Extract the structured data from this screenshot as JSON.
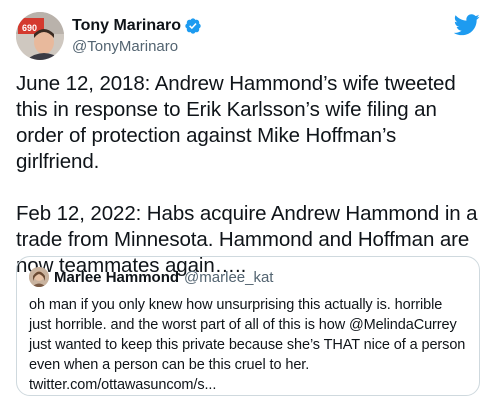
{
  "author": {
    "display_name": "Tony Marinaro",
    "handle": "@TonyMarinaro",
    "verified": true,
    "avatar_badge_text": "690"
  },
  "tweet": {
    "paragraph_1": "June 12, 2018: Andrew Hammond’s wife tweeted this in response to Erik Karlsson’s wife filing an order of protection against Mike Hoffman’s girlfriend.",
    "paragraph_2": "Feb 12, 2022: Habs acquire Andrew Hammond in a trade from Minnesota. Hammond and Hoffman are now teammates again….."
  },
  "quoted_tweet": {
    "display_name": "Marlee Hammond",
    "handle": "@marlee_kat",
    "text": "oh man if you only knew how unsurprising this actually is. horrible just horrible. and the worst part of all of this is how @MelindaCurrey just wanted to keep this private because she’s THAT nice of a person even when a person can be this cruel to her. twitter.com/ottawasuncom/s..."
  },
  "colors": {
    "twitter_blue": "#1d9bf0",
    "text_primary": "#0f1419",
    "text_secondary": "#536471",
    "border": "#cfd9de"
  },
  "icons": {
    "verified": "verified-badge-icon",
    "logo": "twitter-bird-icon"
  }
}
